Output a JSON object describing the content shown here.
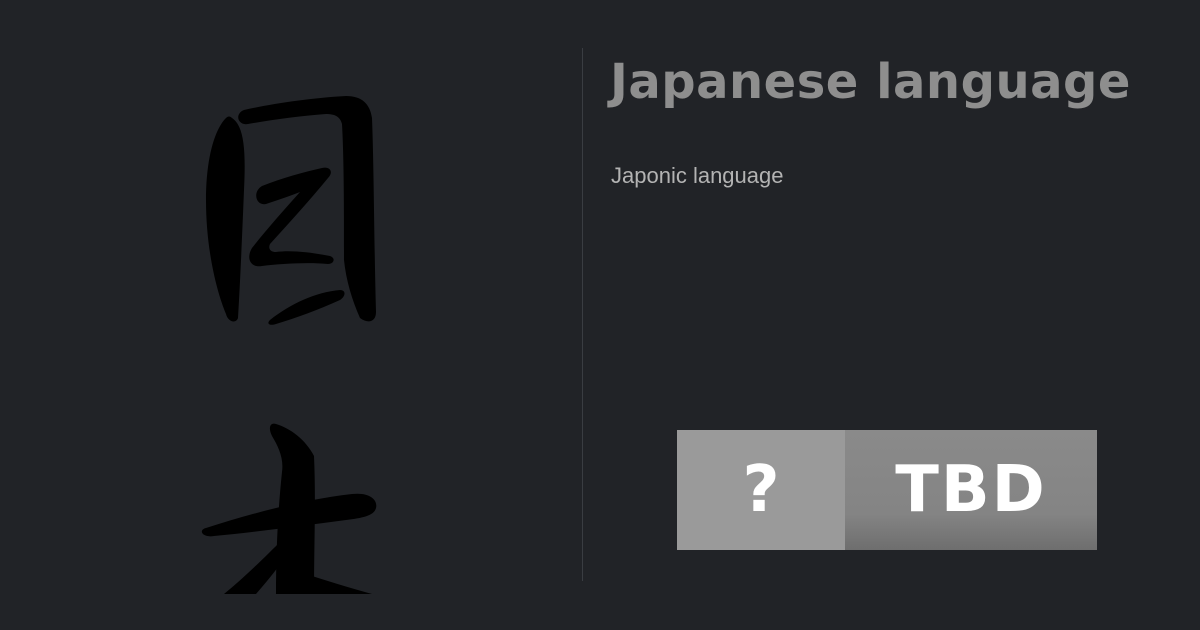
{
  "card": {
    "title": "Japanese language",
    "subtitle": "Japonic language",
    "glyph": {
      "icon": "japanese-kanji-nihon-calligraphy",
      "color": "#000000"
    },
    "badge": {
      "left_label": "?",
      "right_label": "TBD",
      "left_color": "#9a9a9a",
      "right_color": "#848484"
    }
  },
  "colors": {
    "background": "#212327",
    "title": "#8e8e8e",
    "subtitle": "#b3b3b3",
    "divider": "#3a3d42"
  }
}
